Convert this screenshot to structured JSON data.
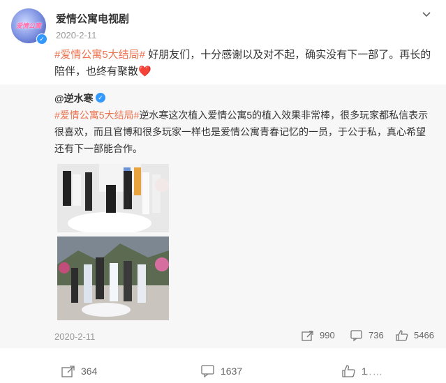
{
  "post": {
    "username": "爱情公寓电视剧",
    "avatar_label": "爱情公寓",
    "time": "2020-2-11",
    "hashtag": "#爱情公寓5大结局#",
    "text": " 好朋友们，十分感谢以及对不起，确实没有下一部了。再长的陪伴，也终有聚散",
    "heart": "❤️"
  },
  "repost": {
    "author": "@逆水寒",
    "hashtag": "#爱情公寓5大结局#",
    "text": "逆水寒这次植入爱情公寓5的植入效果非常棒，很多玩家都私信表示很喜欢，而且官博和很多玩家一样也是爱情公寓青春记忆的一员，于公于私，真心希望还有下一部能合作。",
    "time": "2020-2-11",
    "shares": "990",
    "comments": "736",
    "likes": "5466"
  },
  "footer": {
    "shares": "364",
    "comments": "1637",
    "likes": "1"
  },
  "icons": {
    "verified": "verified-badge-icon",
    "more": "chevron-down-icon",
    "share": "share-icon",
    "comment": "comment-icon",
    "like": "thumbs-up-icon"
  },
  "colors": {
    "hashtag": "#eb7350",
    "verified": "#3399ff",
    "repost_bg": "#f7f7f7"
  }
}
